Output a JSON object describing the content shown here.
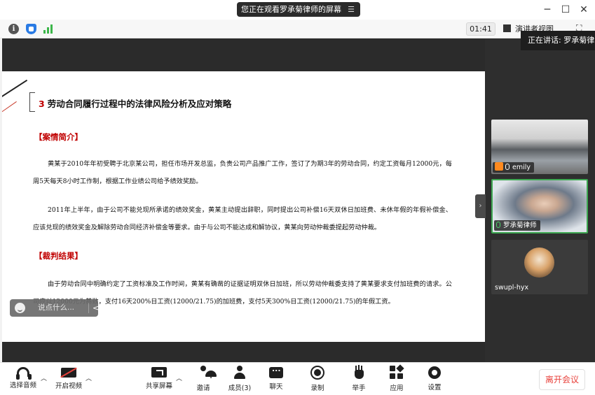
{
  "window": {
    "share_banner": "您正在观看罗承菊律师的屏幕",
    "minimize": "─",
    "maximize": "☐",
    "close": "✕"
  },
  "infobar": {
    "timer": "01:41",
    "view_mode": "演讲者视图",
    "speaking": "正在讲话: 罗承菊律师"
  },
  "slide": {
    "title_number": "3",
    "title": "劳动合同履行过程中的法律风险分析及应对策略",
    "section1": "【案情简介】",
    "para1": "黄某于2010年年初受聘于北京某公司，担任市场开发总监，负责公司产品推广工作，签订了为期3年的劳动合同，约定工资每月12000元，每周5天每天8小时工作制，根据工作业绩公司给予绩效奖励。",
    "para2": "2011年上半年，由于公司不能兑现所承诺的绩效奖金，黄某主动提出辞职，同时提出公司补偿16天双休日加班费、未休年假的年假补偿金、应该兑现的绩效奖金及解除劳动合同经济补偿金等要求。由于与公司不能达成和解协议，黄某向劳动仲裁委提起劳动仲裁。",
    "section2": "【裁判结果】",
    "para3": "由于劳动合同中明确约定了工资标准及工作时间，黄某有确凿的证据证明双休日加班，所以劳动仲裁委支持了黄某要求支付加班费的请求。公司应以12000元为基数，支付16天200%日工资(12000/21.75)的加班费，支付5天300%日工资(12000/21.75)的年假工资。"
  },
  "chat_input": {
    "placeholder": "说点什么..."
  },
  "participants": [
    {
      "name": "emily",
      "role": "host"
    },
    {
      "name": "罗承菊律师",
      "role": "speaker"
    },
    {
      "name": "swupl-hyx",
      "role": "attendee"
    }
  ],
  "toolbar": {
    "audio": "选择音频",
    "video": "开启视频",
    "share": "共享屏幕",
    "invite": "邀请",
    "members": "成员(3)",
    "chat": "聊天",
    "record": "录制",
    "raise_hand": "举手",
    "apps": "应用",
    "settings": "设置",
    "leave": "离开会议"
  },
  "colors": {
    "accent_red": "#c00000",
    "leave_red": "#e8413b",
    "active_green": "#3ea852"
  }
}
